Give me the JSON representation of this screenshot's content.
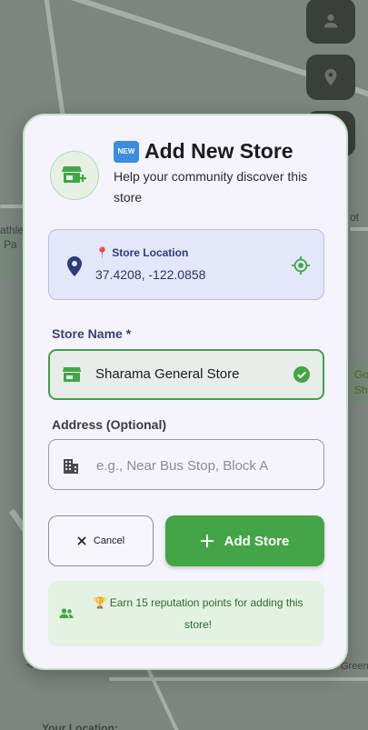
{
  "map": {
    "labels": [
      "athle",
      "Pa",
      "Amherst",
      "Go",
      "Sh",
      "Green",
      "Your Location:",
      "ot"
    ]
  },
  "colors": {
    "accent_green": "#43a547",
    "location_card": "#e4e7fa",
    "modal_bg": "#f5f3fb"
  },
  "dialog": {
    "header_icon": "store-add-icon",
    "title_badge": "NEW",
    "title": "Add New Store",
    "subtitle": "Help your community discover this store",
    "location": {
      "label": "📍 Store Location",
      "value": "37.4208, -122.0858",
      "icon": "map-pin-icon",
      "action_icon": "my-location-icon"
    },
    "store_name": {
      "label": "Store Name *",
      "value": "Sharama General Store",
      "valid": true
    },
    "address": {
      "label": "Address (Optional)",
      "placeholder": "e.g., Near Bus Stop, Block A",
      "value": ""
    },
    "cancel_label": "Cancel",
    "add_label": "Add Store",
    "tip": "🏆 Earn 15 reputation points for adding this store!"
  }
}
